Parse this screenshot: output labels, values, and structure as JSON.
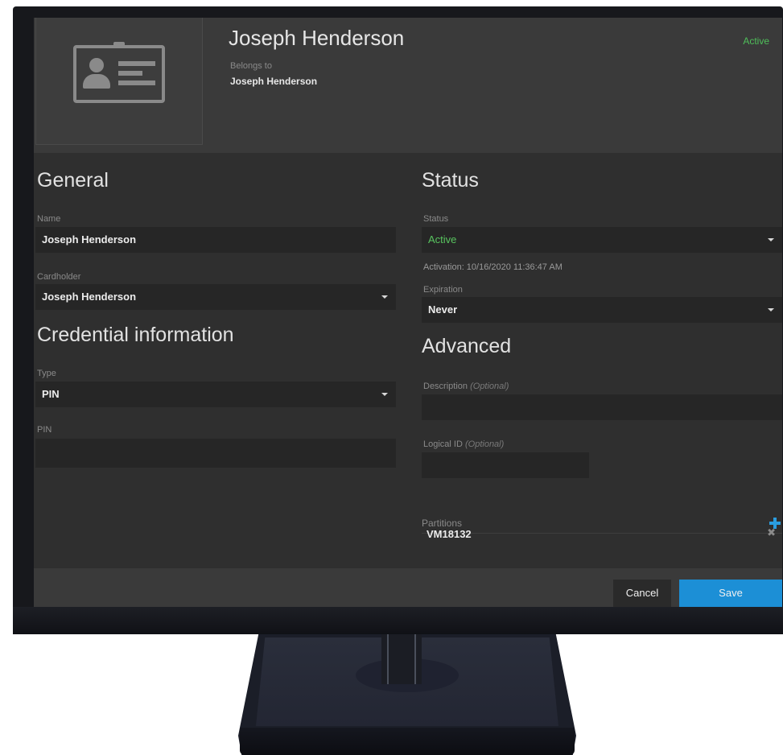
{
  "header": {
    "title": "Joseph Henderson",
    "belongs_label": "Belongs to",
    "belongs_value": "Joseph Henderson",
    "status": "Active"
  },
  "general": {
    "title": "General",
    "name_label": "Name",
    "name_value": "Joseph Henderson",
    "cardholder_label": "Cardholder",
    "cardholder_value": "Joseph Henderson"
  },
  "credential": {
    "title": "Credential information",
    "type_label": "Type",
    "type_value": "PIN",
    "pin_label": "PIN",
    "pin_value": ""
  },
  "status": {
    "title": "Status",
    "status_label": "Status",
    "status_value": "Active",
    "activation_text": "Activation: 10/16/2020 11:36:47 AM",
    "expiration_label": "Expiration",
    "expiration_value": "Never"
  },
  "advanced": {
    "title": "Advanced",
    "description_label": "Description",
    "description_optional": "(Optional)",
    "logical_id_label": "Logical ID",
    "logical_id_optional": "(Optional)",
    "partitions_label": "Partitions",
    "partitions": [
      "VM18132"
    ]
  },
  "footer": {
    "cancel_label": "Cancel",
    "save_label": "Save"
  },
  "colors": {
    "accent": "#1c8fd6",
    "active_green": "#58c45f"
  }
}
